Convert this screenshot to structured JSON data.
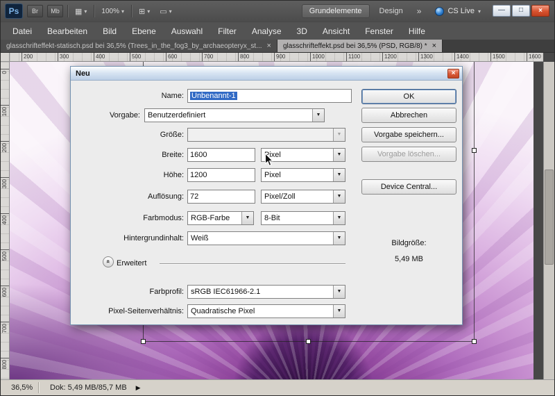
{
  "colors": {
    "selection_blue": "#316ac5",
    "close_red": "#d9532f",
    "ps_logo_navy": "#10243c",
    "cs_live_blue": "#2f7fd0"
  },
  "icons": {
    "chevron_down": "▼",
    "caret_down": "▾",
    "close": "×",
    "minimize": "—",
    "maximize": "□",
    "overflow": "»",
    "collapse_double": "»",
    "view_extras": "▦",
    "arrange_documents": "⊞",
    "screen_mode": "▭",
    "status_arrow": "▶"
  },
  "titlebar": {
    "logo": "Ps",
    "bridge": "Br",
    "minibridge": "Mb",
    "zoom_value": "100%",
    "workspaces": [
      {
        "label": "Grundelemente",
        "active": true
      },
      {
        "label": "Design",
        "active": false
      }
    ],
    "cs_live": "CS Live"
  },
  "menubar": [
    "Datei",
    "Bearbeiten",
    "Bild",
    "Ebene",
    "Auswahl",
    "Filter",
    "Analyse",
    "3D",
    "Ansicht",
    "Fenster",
    "Hilfe"
  ],
  "tabs": [
    {
      "label": "glasschrifteffekt-statisch.psd bei 36,5% (Trees_in_the_fog3_by_archaeopteryx_st...",
      "active": false
    },
    {
      "label": "glasschrifteffekt.psd bei 36,5% (PSD, RGB/8) *",
      "active": true
    }
  ],
  "rulers": {
    "horizontal": [
      "200",
      "300",
      "400",
      "500",
      "600",
      "700",
      "800",
      "900",
      "1000",
      "1100",
      "1200",
      "1300",
      "1400",
      "1500",
      "1600"
    ],
    "vertical": [
      "0",
      "100",
      "200",
      "300",
      "400",
      "500",
      "600",
      "700",
      "800"
    ]
  },
  "dialog": {
    "title": "Neu",
    "rows": {
      "name": {
        "label": "Name:",
        "value": "Unbenannt-1"
      },
      "preset": {
        "label": "Vorgabe:",
        "value": "Benutzerdefiniert"
      },
      "size": {
        "label": "Größe:",
        "value": ""
      },
      "width": {
        "label": "Breite:",
        "value": "1600",
        "unit": "Pixel"
      },
      "height": {
        "label": "Höhe:",
        "value": "1200",
        "unit": "Pixel"
      },
      "resolution": {
        "label": "Auflösung:",
        "value": "72",
        "unit": "Pixel/Zoll"
      },
      "colormode": {
        "label": "Farbmodus:",
        "value": "RGB-Farbe",
        "depth": "8-Bit"
      },
      "background": {
        "label": "Hintergrundinhalt:",
        "value": "Weiß"
      },
      "advanced": {
        "label": "Erweitert"
      },
      "profile": {
        "label": "Farbprofil:",
        "value": "sRGB IEC61966-2.1"
      },
      "aspect": {
        "label": "Pixel-Seitenverhältnis:",
        "value": "Quadratische Pixel"
      }
    },
    "buttons": {
      "ok": "OK",
      "cancel": "Abbrechen",
      "save_preset": "Vorgabe speichern...",
      "delete_preset": "Vorgabe löschen...",
      "device_central": "Device Central..."
    },
    "image_size_label": "Bildgröße:",
    "image_size_value": "5,49 MB"
  },
  "statusbar": {
    "zoom": "36,5%",
    "doc": "Dok: 5,49 MB/85,7 MB"
  }
}
